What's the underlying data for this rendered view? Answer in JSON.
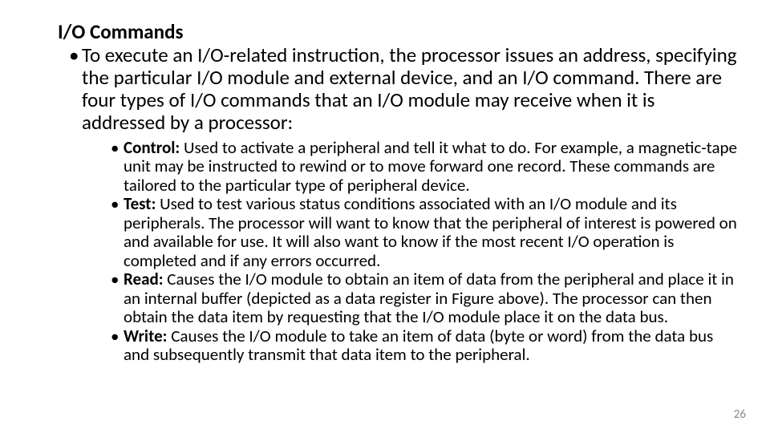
{
  "title": "I/O Commands",
  "intro": "To execute an I/O-related instruction, the processor issues an address, specifying the particular I/O module and external device, and an I/O command. There are four types of I/O commands that an I/O module may receive when it is addressed by a processor:",
  "items": [
    {
      "label": " Control:",
      "text": " Used to activate a peripheral and tell it what to do. For example, a magnetic-tape unit may be instructed to rewind or to move forward one record. These commands are tailored to the particular type of peripheral device."
    },
    {
      "label": "Test:",
      "text": " Used to test various status conditions associated with an I/O module and its peripherals. The processor will want to know that the peripheral of interest is powered on and available for use. It will also want to know if the most recent I/O operation is completed and if any errors occurred."
    },
    {
      "label": "Read:",
      "text": " Causes the I/O module to obtain an item of data from the peripheral and place it in an internal buffer (depicted as a data register in Figure above). The processor can then obtain the data item by requesting that the I/O module place it on the data bus."
    },
    {
      "label": "Write:",
      "text": " Causes the I/O module to take an item of data (byte or word) from the data bus and subsequently transmit that data item to the peripheral."
    }
  ],
  "page": "26"
}
